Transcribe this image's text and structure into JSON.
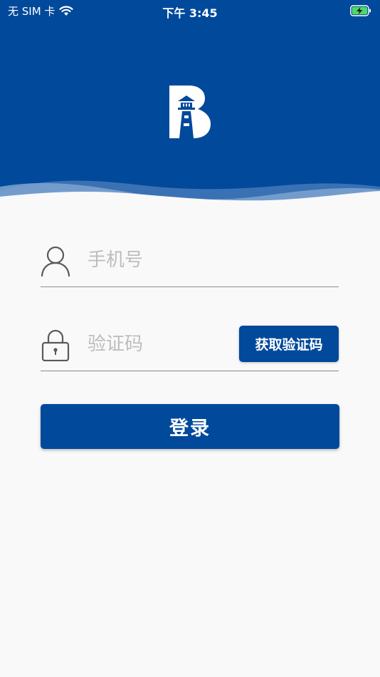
{
  "status_bar": {
    "carrier": "无 SIM 卡",
    "time": "下午 3:45",
    "wifi_icon": "wifi-icon",
    "battery_icon": "battery-charging-icon"
  },
  "logo": {
    "icon": "lighthouse-b-logo"
  },
  "form": {
    "phone": {
      "placeholder": "手机号",
      "value": "",
      "icon": "user-icon"
    },
    "code": {
      "placeholder": "验证码",
      "value": "",
      "icon": "lock-icon"
    },
    "get_code_label": "获取验证码",
    "login_label": "登录"
  },
  "colors": {
    "brand": "#01499b",
    "background": "#f9f9fa",
    "placeholder": "#bdbdbd",
    "battery_green": "#4cd964"
  }
}
